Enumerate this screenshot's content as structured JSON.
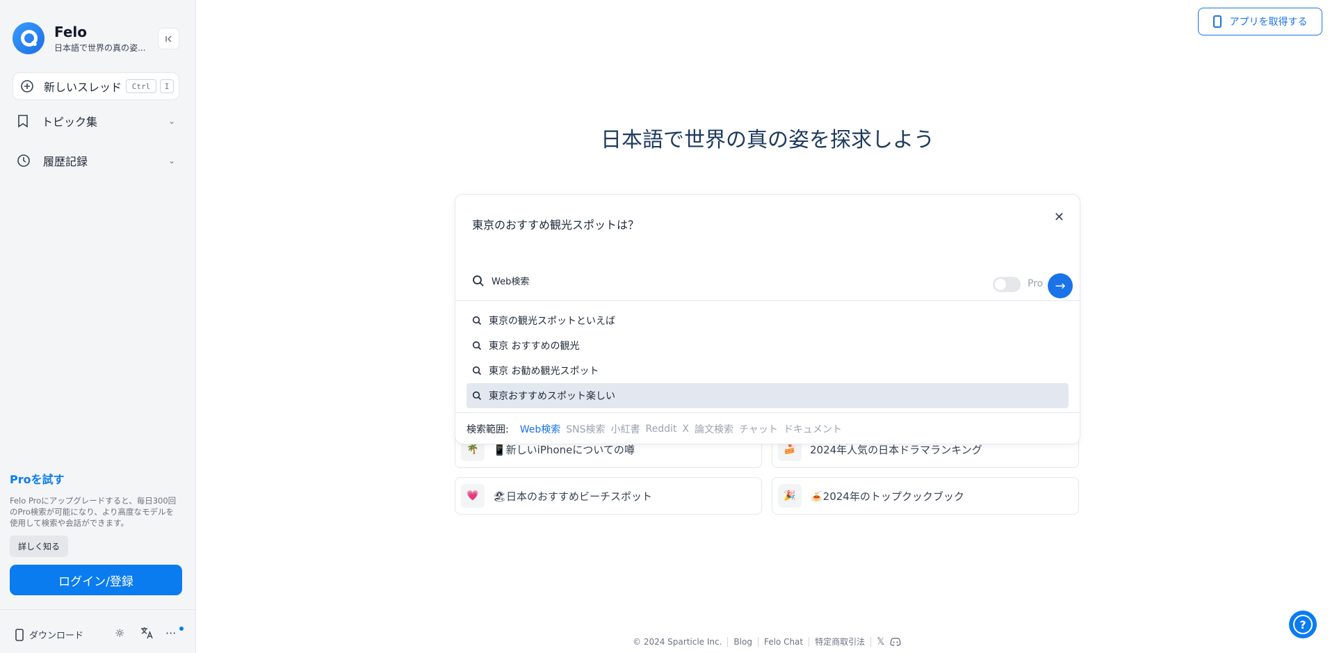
{
  "brand": {
    "name": "Felo",
    "tagline": "日本語で世界の真の姿..."
  },
  "sidebar": {
    "new_thread": {
      "label": "新しいスレッド",
      "shortcut_ctrl": "Ctrl",
      "shortcut_key": "I"
    },
    "nav": [
      {
        "label": "トピック集",
        "icon": "bookmark-icon"
      },
      {
        "label": "履歴記録",
        "icon": "history-icon"
      }
    ],
    "pro": {
      "title": "Proを試す",
      "description": "Felo Proにアップグレードすると、毎日300回のPro検索が可能になり、より高度なモデルを使用して検索や会話ができます。",
      "learn_more": "詳しく知る"
    },
    "login_label": "ログイン/登録",
    "footer": {
      "download_label": "ダウンロード"
    }
  },
  "header": {
    "get_app_label": "アプリを取得する"
  },
  "main": {
    "hero_title": "日本語で世界の真の姿を探求しよう",
    "search": {
      "query": "東京のおすすめ観光スポットは？",
      "mode_label": "Web検索",
      "pro_label": "Pro",
      "suggestions": [
        "東京の観光スポットといえば",
        "東京 おすすめの観光",
        "東京 お勧め観光スポット",
        "東京おすすめスポット楽しい"
      ],
      "active_suggestion": 3,
      "scope_label": "検索範囲:",
      "scope_options": [
        "Web検索",
        "SNS検索",
        "小紅書",
        "Reddit",
        "X",
        "論文検索",
        "チャット",
        "ドキュメント"
      ],
      "scope_selected": "Web検索"
    },
    "topics": [
      {
        "emoji": "🌴",
        "label": "📱新しいiPhoneについての噂"
      },
      {
        "emoji": "🍰",
        "label": "2024年人気の日本ドラマランキング"
      },
      {
        "emoji": "💗",
        "label": "🏖日本のおすすめビーチスポット"
      },
      {
        "emoji": "🎉",
        "label": "🍝2024年のトップクックブック"
      }
    ]
  },
  "footer": {
    "copyright": "© 2024 Sparticle Inc.",
    "links": [
      "Blog",
      "Felo Chat",
      "特定商取引法"
    ]
  },
  "colors": {
    "accent": "#0a7cf0",
    "hero_text": "#1e3a5f"
  }
}
